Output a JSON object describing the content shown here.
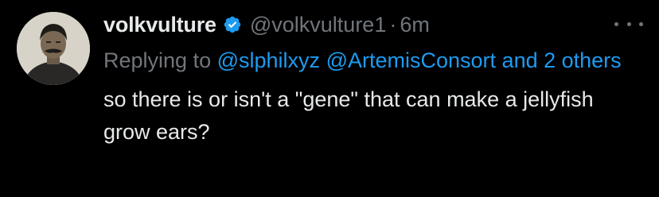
{
  "author": {
    "display_name": "volkvulture",
    "handle": "@volkvulture1",
    "separator": "·",
    "time": "6m",
    "verified_icon": "verified-badge-icon",
    "verified_color": "#1d9bf0"
  },
  "reply": {
    "prefix": "Replying to",
    "mention_1": "@slphilxyz",
    "mention_2": "@ArtemisConsort",
    "others_text": "and 2 others"
  },
  "tweet": {
    "text": "so there is or isn't a \"gene\" that can make a jellyfish grow ears?"
  },
  "icons": {
    "more": "more-options-icon"
  },
  "colors": {
    "background": "#000000",
    "text": "#e7e9ea",
    "secondary": "#71767b",
    "accent": "#1d9bf0"
  }
}
